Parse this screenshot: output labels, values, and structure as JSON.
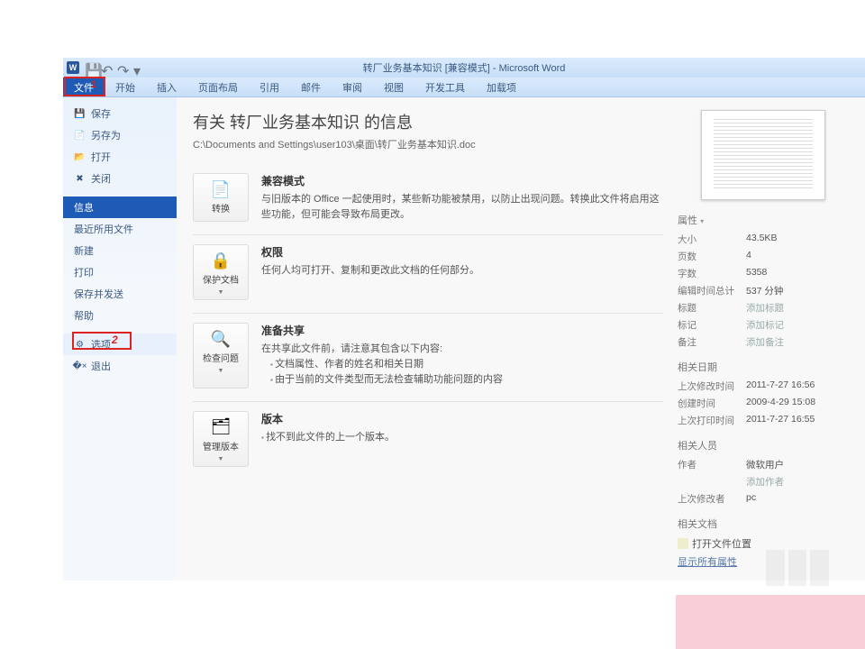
{
  "titlebar": {
    "title": "转厂业务基本知识 [兼容模式] - Microsoft Word"
  },
  "ribbon": {
    "file": "文件",
    "home": "开始",
    "insert": "插入",
    "layout": "页面布局",
    "references": "引用",
    "mailings": "邮件",
    "review": "审阅",
    "view": "视图",
    "developer": "开发工具",
    "addins": "加载项"
  },
  "highlights": {
    "n1": "1",
    "n2": "2"
  },
  "nav": {
    "save": "保存",
    "save_as": "另存为",
    "open": "打开",
    "close": "关闭",
    "info": "信息",
    "recent": "最近所用文件",
    "new": "新建",
    "print": "打印",
    "save_send": "保存并发送",
    "help": "帮助",
    "options": "选项",
    "exit": "退出"
  },
  "info": {
    "title_prefix": "有关 ",
    "title_doc": "转厂业务基本知识",
    "title_suffix": " 的信息",
    "path": "C:\\Documents and Settings\\user103\\桌面\\转厂业务基本知识.doc",
    "compat": {
      "tile": "转换",
      "heading": "兼容模式",
      "body": "与旧版本的 Office 一起使用时，某些新功能被禁用，以防止出现问题。转换此文件将启用这些功能，但可能会导致布局更改。"
    },
    "perm": {
      "tile": "保护文档",
      "heading": "权限",
      "body": "任何人均可打开、复制和更改此文档的任何部分。"
    },
    "share": {
      "tile": "检查问题",
      "heading": "准备共享",
      "body": "在共享此文件前，请注意其包含以下内容:",
      "li1": "文档属性、作者的姓名和相关日期",
      "li2": "由于当前的文件类型而无法检查辅助功能问题的内容"
    },
    "versions": {
      "tile": "管理版本",
      "heading": "版本",
      "body": "找不到此文件的上一个版本。"
    }
  },
  "side": {
    "props_heading": "属性",
    "dot": "▾",
    "size_l": "大小",
    "size_v": "43.5KB",
    "pages_l": "页数",
    "pages_v": "4",
    "words_l": "字数",
    "words_v": "5358",
    "edit_l": "编辑时间总计",
    "edit_v": "537 分钟",
    "title_l": "标题",
    "title_v": "添加标题",
    "tags_l": "标记",
    "tags_v": "添加标记",
    "comments_l": "备注",
    "comments_v": "添加备注",
    "dates_heading": "相关日期",
    "mod_l": "上次修改时间",
    "mod_v": "2011-7-27 16:56",
    "created_l": "创建时间",
    "created_v": "2009-4-29 15:08",
    "printed_l": "上次打印时间",
    "printed_v": "2011-7-27 16:55",
    "people_heading": "相关人员",
    "author_l": "作者",
    "author_v": "微软用户",
    "add_author": "添加作者",
    "lastmod_l": "上次修改者",
    "lastmod_v": "pc",
    "docs_heading": "相关文档",
    "open_loc": "打开文件位置",
    "show_all": "显示所有属性"
  }
}
